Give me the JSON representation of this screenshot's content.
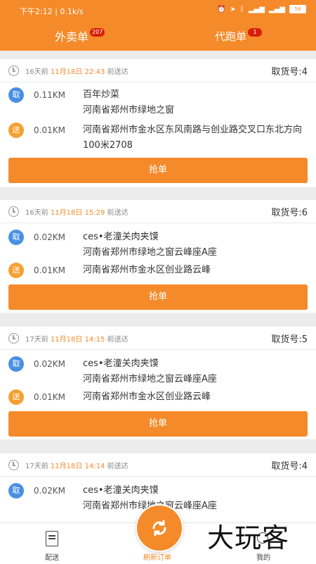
{
  "status_bar": {
    "time_text": "下午2:12 | 0.1k/s",
    "battery": "56",
    "icons": [
      "alarm-icon",
      "location-icon",
      "bluetooth-icon",
      "signal-icon",
      "wifi-icon",
      "battery-icon"
    ]
  },
  "tabs": [
    {
      "label": "外卖单",
      "badge": "207",
      "active": true
    },
    {
      "label": "代跑单",
      "badge": "1",
      "active": false
    }
  ],
  "orders": [
    {
      "time_prefix": "16天前",
      "date": "11月18日",
      "time": "22:43",
      "suffix": "前送达",
      "pickup_no": "取货号:4",
      "pickup_badge": "取",
      "pickup_distance": "0.11KM",
      "pickup_address": "百年炒菜\n河南省郑州市绿地之窗",
      "delivery_badge": "送",
      "delivery_distance": "0.01KM",
      "delivery_address": "河南省郑州市金水区东风南路与创业路交叉口东北方向100米2708",
      "button": "抢单"
    },
    {
      "time_prefix": "16天前",
      "date": "11月18日",
      "time": "15:29",
      "suffix": "前送达",
      "pickup_no": "取货号:6",
      "pickup_badge": "取",
      "pickup_distance": "0.02KM",
      "pickup_address": "ces•老潼关肉夹馍\n河南省郑州市绿地之窗云峰座A座",
      "delivery_badge": "送",
      "delivery_distance": "0.01KM",
      "delivery_address": "河南省郑州市金水区创业路云峰",
      "button": "抢单"
    },
    {
      "time_prefix": "17天前",
      "date": "11月18日",
      "time": "14:15",
      "suffix": "前送达",
      "pickup_no": "取货号:5",
      "pickup_badge": "取",
      "pickup_distance": "0.02KM",
      "pickup_address": "ces•老潼关肉夹馍\n河南省郑州市绿地之窗云峰座A座",
      "delivery_badge": "送",
      "delivery_distance": "0.01KM",
      "delivery_address": "河南省郑州市金水区创业路云峰",
      "button": "抢单"
    },
    {
      "time_prefix": "17天前",
      "date": "11月18日",
      "time": "14:14",
      "suffix": "前送达",
      "pickup_no": "取货号:4",
      "pickup_badge": "取",
      "pickup_distance": "0.02KM",
      "pickup_address": "ces•老潼关肉夹馍\n河南省郑州市绿地之窗云峰座A座",
      "delivery_badge": "送",
      "delivery_distance": "",
      "delivery_address": "",
      "button": ""
    }
  ],
  "bottom_nav": {
    "left": "配送",
    "middle": "刷新订单",
    "right": "我的"
  },
  "watermark": "大玩客",
  "colors": {
    "brand": "#f58a2a",
    "pickup": "#4a90e2",
    "delivery": "#f5a033",
    "badge": "#d81e06"
  }
}
